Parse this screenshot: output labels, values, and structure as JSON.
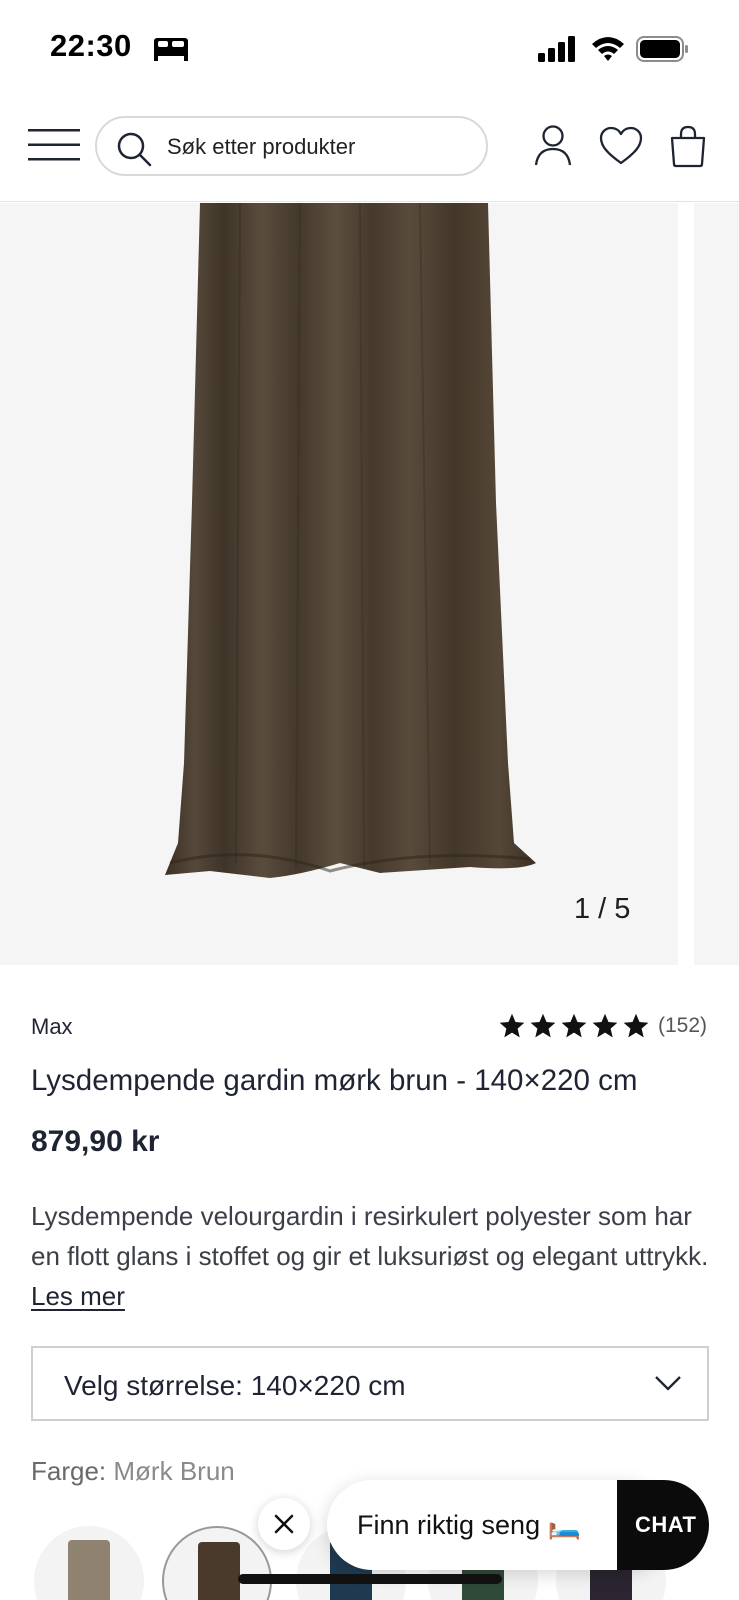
{
  "status_bar": {
    "time": "22:30",
    "icons": [
      "bed-icon",
      "signal-icon",
      "wifi-icon",
      "battery-icon"
    ]
  },
  "header": {
    "search_placeholder": "Søk etter produkter",
    "icons": [
      "menu-icon",
      "search-icon",
      "account-icon",
      "heart-icon",
      "bag-icon"
    ]
  },
  "gallery": {
    "counter": "1 / 5",
    "image": "curtain-dark-brown"
  },
  "product": {
    "brand": "Max",
    "rating_stars": 5,
    "rating_count": "(152)",
    "title": "Lysdempende gardin mørk brun - 140×220 cm",
    "price": "879,90 kr",
    "description": "Lysdempende velourgardin i resirkulert polyester som har en flott glans i stoffet og gir et luksuriøst og elegant uttrykk.",
    "read_more": "Les mer"
  },
  "size_select": {
    "label": "Velg størrelse: 140×220 cm"
  },
  "color": {
    "label": "Farge:",
    "value": "Mørk Brun",
    "swatch_colors": [
      "#8f8270",
      "#4a3a2c",
      "#1f3a50",
      "#2f4a38",
      "#2a2530"
    ]
  },
  "floating": {
    "finder_text": "Finn riktig seng 🛏️",
    "chat_label": "CHAT"
  },
  "colors": {
    "text_primary": "#1f2433",
    "curtain": "#4b3f30",
    "chat_bg": "#0b0b0b"
  }
}
